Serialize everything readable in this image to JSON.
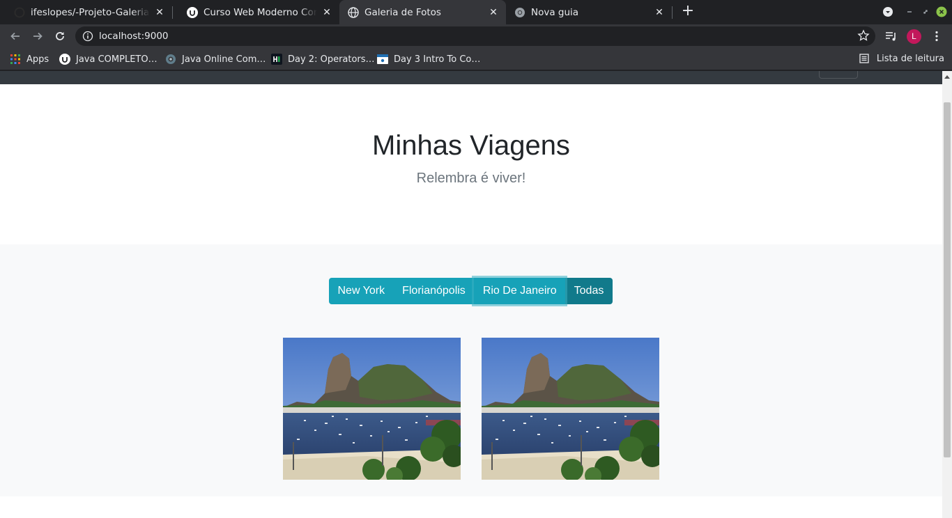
{
  "browser": {
    "tabs": [
      {
        "title": "ifeslopes/-Projeto-Galeria: Pr",
        "favicon": "github-icon",
        "active": false
      },
      {
        "title": "Curso Web Moderno Complet",
        "favicon": "udemy-icon",
        "active": false
      },
      {
        "title": "Galeria de Fotos",
        "favicon": "globe-icon",
        "active": true
      },
      {
        "title": "Nova guia",
        "favicon": "chrome-icon",
        "active": false
      }
    ],
    "close_symbol": "✕",
    "new_tab_symbol": "+",
    "url": "localhost:9000",
    "avatar_letter": "L",
    "avatar_color": "#c2185b"
  },
  "bookmarks": {
    "items": [
      {
        "label": "Apps",
        "icon": "apps-grid-icon"
      },
      {
        "label": "Java COMPLETO…",
        "icon": "udemy-icon"
      },
      {
        "label": "Java Online Com…",
        "icon": "compiler-icon"
      },
      {
        "label": "Day 2: Operators…",
        "icon": "hackerrank-icon"
      },
      {
        "label": "Day 3 Intro To Co…",
        "icon": "page-icon"
      }
    ],
    "reading_list": "Lista de leitura"
  },
  "page": {
    "title": "Minhas Viagens",
    "subtitle": "Relembra é viver!",
    "filters": [
      {
        "label": "New York",
        "state": "normal"
      },
      {
        "label": "Florianópolis",
        "state": "normal"
      },
      {
        "label": "Rio De Janeiro",
        "state": "focused"
      },
      {
        "label": "Todas",
        "state": "active"
      }
    ],
    "photos": [
      {
        "name": "rio-de-janeiro-photo-1",
        "subject": "Sugarloaf Mountain and Botafogo bay"
      },
      {
        "name": "rio-de-janeiro-photo-2",
        "subject": "Sugarloaf Mountain and Botafogo bay"
      }
    ],
    "colors": {
      "info": "#17a2b8",
      "info_active": "#117a8b",
      "dark_nav": "#343a40",
      "gallery_bg": "#f8f9fa"
    }
  }
}
